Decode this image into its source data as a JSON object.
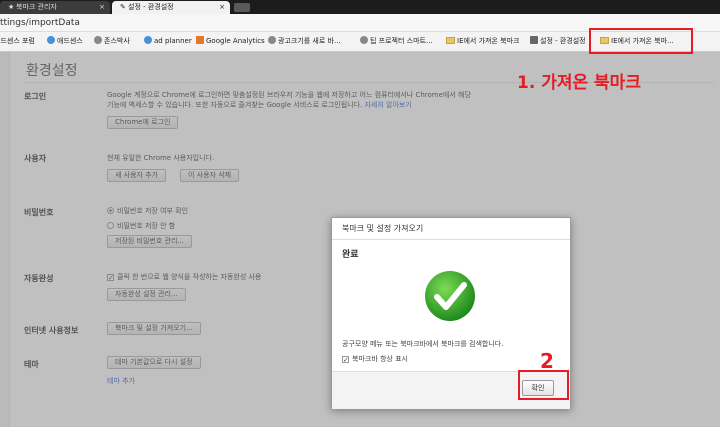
{
  "tabs": [
    {
      "label": "북마크 관리자",
      "icon": "star-icon"
    },
    {
      "label": "설정 - 환경설정",
      "icon": "wrench-icon"
    }
  ],
  "url": "ttings/importData",
  "bookmarks": [
    {
      "label": "애드센스 포럼",
      "icon": "site-icon",
      "color": "#4a90d9"
    },
    {
      "label": "애드센스",
      "icon": "site-icon",
      "color": "#4a90d9"
    },
    {
      "label": "존스박사",
      "icon": "site-icon",
      "color": "#888888"
    },
    {
      "label": "ad planner",
      "icon": "site-icon",
      "color": "#4a90d9"
    },
    {
      "label": "Google Analytics",
      "icon": "analytics-icon",
      "color": "#e87722"
    },
    {
      "label": "광고크기를 새로 바...",
      "icon": "site-icon",
      "color": "#888888"
    },
    {
      "label": "팁 프로젝터 스마트...",
      "icon": "site-icon",
      "color": "#888888"
    },
    {
      "label": "IE에서 가져온 북마크",
      "icon": "folder-icon",
      "color": "#e8c766"
    },
    {
      "label": "설정 - 환경설정",
      "icon": "wrench-icon",
      "color": "#666666"
    },
    {
      "label": "IE에서 가져온 북마...",
      "icon": "folder-icon",
      "color": "#e8c766"
    }
  ],
  "page": {
    "title": "환경설정",
    "login": {
      "label": "로그인",
      "desc1": "Google 계정으로 Chrome에 로그인하면 맞춤설정된 브라우저 기능을 웹에 저장하고 어느 컴퓨터에서나 Chrome에서 해당",
      "desc2": "기능에 액세스할 수 있습니다. 또한 자동으로 즐겨찾는 Google 서비스로 로그인됩니다.",
      "learn_more": "자세히 알아보기",
      "button": "Chrome에 로그인"
    },
    "users": {
      "label": "사용자",
      "desc": "현재 유일한 Chrome 사용자입니다.",
      "add_button": "새 사용자 추가",
      "delete_button": "이 사용자 삭제"
    },
    "passwords": {
      "label": "비밀번호",
      "option1": "비밀번호 저장 여부 확인",
      "option2": "비밀번호 저장 안 함",
      "button": "저장된 비밀번호 관리..."
    },
    "autofill": {
      "label": "자동완성",
      "option": "클릭 한 번으로 웹 양식을 작성하는 자동완성 사용",
      "button": "자동완성 설정 관리..."
    },
    "browser": {
      "label": "인터넷 사용정보",
      "button": "북마크 및 설정 가져오기..."
    },
    "theme": {
      "label": "테마",
      "button": "테마 기본값으로 다시 설정",
      "link": "테마 추가"
    }
  },
  "dialog": {
    "title": "북마크 및 설정 가져오기",
    "status": "완료",
    "message": "공구모양 메뉴 또는 북마크바에서 북마크를 검색합니다.",
    "checkbox_label": "북마크바 항상 표시",
    "checkbox_checked": true,
    "ok_button": "확인",
    "check_color": "#2fa52b"
  },
  "annotations": {
    "label1": "1. 가져온 북마크",
    "label2": "2",
    "color": "#e51c23"
  }
}
